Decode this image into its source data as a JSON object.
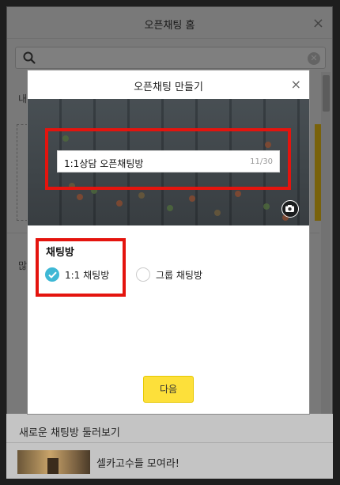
{
  "background": {
    "window_title": "오픈채팅 홈",
    "close_glyph": "×",
    "search_placeholder": "",
    "side_text_1": "내",
    "side_text_2": "많",
    "bottom_section_title": "새로운 채팅방 둘러보기",
    "bottom_item_title": "셀카고수들 모여라!"
  },
  "modal": {
    "title": "오픈채팅 만들기",
    "close_glyph": "×",
    "chat_name_value": "1:1상담 오픈채팅방",
    "char_count": "11/30",
    "room_type_label": "채팅방",
    "options": [
      {
        "label": "1:1 채팅방",
        "selected": true
      },
      {
        "label": "그룹 채팅방",
        "selected": false
      }
    ],
    "next_button": "다음"
  },
  "colors": {
    "accent_yellow": "#fde03a",
    "check_blue": "#3eb8d5",
    "highlight_red": "#e4140e"
  },
  "icons": [
    "search-icon",
    "clear-search-icon",
    "close-icon",
    "camera-icon",
    "check-icon"
  ]
}
